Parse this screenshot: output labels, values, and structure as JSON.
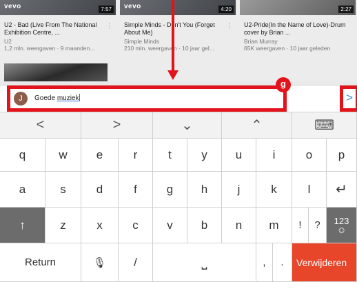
{
  "videos": [
    {
      "brand": "vevo",
      "duration": "7:57",
      "title": "U2 - Bad (Live From The National Exhibition Centre, ...",
      "channel": "U2",
      "meta": "1,2 mln. weergaven · 9 maanden..."
    },
    {
      "brand": "vevo",
      "duration": "4:20",
      "title": "Simple Minds - Don't You (Forget About Me)",
      "channel": "Simple Minds",
      "meta": "210 mln. weergaven · 10 jaar gel..."
    },
    {
      "brand": "",
      "duration": "2:27",
      "title": "U2-Pride(In the Name of Love)-Drum cover by Brian ...",
      "channel": "Brian Murray",
      "meta": "65K weergaven · 10 jaar geleden"
    }
  ],
  "comment": {
    "avatar_letter": "J",
    "text_prefix": "Goede ",
    "text_word": "muziek"
  },
  "annotation": {
    "badge": "g",
    "color": "#e3131b"
  },
  "send_icon": "send-arrow-icon",
  "keyboard": {
    "nav": [
      "<",
      ">",
      "⌄",
      "⌃",
      "⌨"
    ],
    "row1": [
      "q",
      "w",
      "e",
      "r",
      "t",
      "y",
      "u",
      "i",
      "o",
      "p"
    ],
    "row2": [
      "a",
      "s",
      "d",
      "f",
      "g",
      "h",
      "j",
      "k",
      "l",
      "↵"
    ],
    "row3": [
      "↑",
      "z",
      "x",
      "c",
      "v",
      "b",
      "n",
      "m",
      "!",
      "?",
      "123",
      "☺"
    ],
    "return_label": "Return",
    "mic": "🎙",
    "slash": "/",
    "space": "⎵",
    "comma": ",",
    "period": ".",
    "delete_label": "Verwijderen"
  }
}
